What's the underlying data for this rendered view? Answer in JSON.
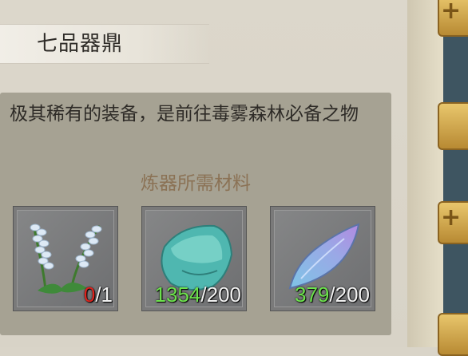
{
  "item": {
    "name": "七品器鼎",
    "description": "极其稀有的装备，是前往毒雾森林必备之物"
  },
  "materials_header": "炼器所需材料",
  "materials": [
    {
      "icon": "herb-icon",
      "have": "0",
      "need": "/1",
      "enough": false
    },
    {
      "icon": "jade-ore-icon",
      "have": "1354",
      "need": "/200",
      "enough": true
    },
    {
      "icon": "crystal-shard-icon",
      "have": "379",
      "need": "/200",
      "enough": true
    }
  ],
  "side_tabs": [
    {
      "symbol": "+"
    },
    {
      "symbol": "+"
    }
  ],
  "colors": {
    "insufficient": "#e0221c",
    "sufficient": "#6de34d"
  }
}
